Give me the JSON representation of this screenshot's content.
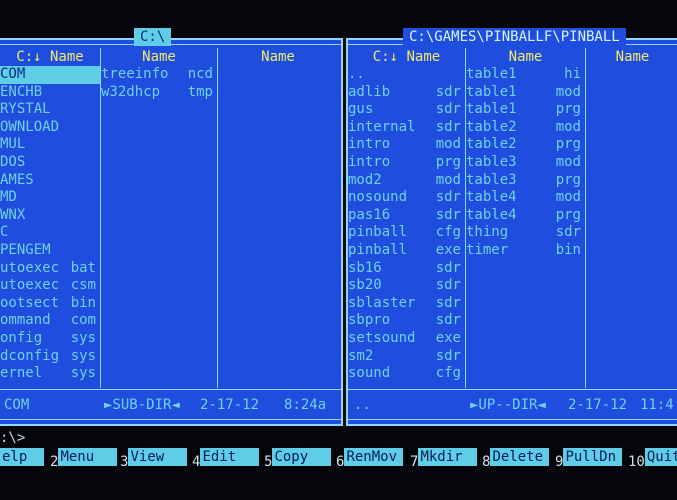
{
  "left": {
    "path": "C:\\",
    "columns": [
      {
        "header": "C:↓ Name",
        "entries": [
          {
            "name": "COM",
            "ext": "",
            "selected": true
          },
          {
            "name": "ENCHB",
            "ext": ""
          },
          {
            "name": "RYSTAL",
            "ext": ""
          },
          {
            "name": "OWNLOAD",
            "ext": ""
          },
          {
            "name": "MUL",
            "ext": ""
          },
          {
            "name": "DOS",
            "ext": ""
          },
          {
            "name": "AMES",
            "ext": ""
          },
          {
            "name": "MD",
            "ext": ""
          },
          {
            "name": "WNX",
            "ext": ""
          },
          {
            "name": "C",
            "ext": ""
          },
          {
            "name": "PENGEM",
            "ext": ""
          },
          {
            "name": "utoexec",
            "ext": "bat"
          },
          {
            "name": "utoexec",
            "ext": "csm"
          },
          {
            "name": "ootsect",
            "ext": "bin"
          },
          {
            "name": "ommand",
            "ext": "com"
          },
          {
            "name": "onfig",
            "ext": "sys"
          },
          {
            "name": "dconfig",
            "ext": "sys"
          },
          {
            "name": "ernel",
            "ext": "sys"
          }
        ]
      },
      {
        "header": "Name",
        "entries": [
          {
            "name": "treeinfo",
            "ext": "ncd"
          },
          {
            "name": "w32dhcp",
            "ext": "tmp"
          }
        ]
      },
      {
        "header": "Name",
        "entries": []
      }
    ],
    "status": {
      "name": "COM",
      "type": "►SUB-DIR◄",
      "date": "2-17-12",
      "time": "8:24a"
    }
  },
  "right": {
    "path": "C:\\GAMES\\PINBALLF\\PINBALL",
    "columns": [
      {
        "header": "C:↓ Name",
        "entries": [
          {
            "name": "..",
            "ext": ""
          },
          {
            "name": "adlib",
            "ext": "sdr"
          },
          {
            "name": "gus",
            "ext": "sdr"
          },
          {
            "name": "internal",
            "ext": "sdr"
          },
          {
            "name": "intro",
            "ext": "mod"
          },
          {
            "name": "intro",
            "ext": "prg"
          },
          {
            "name": "mod2",
            "ext": "mod"
          },
          {
            "name": "nosound",
            "ext": "sdr"
          },
          {
            "name": "pas16",
            "ext": "sdr"
          },
          {
            "name": "pinball",
            "ext": "cfg"
          },
          {
            "name": "pinball",
            "ext": "exe"
          },
          {
            "name": "sb16",
            "ext": "sdr"
          },
          {
            "name": "sb20",
            "ext": "sdr"
          },
          {
            "name": "sblaster",
            "ext": "sdr"
          },
          {
            "name": "sbpro",
            "ext": "sdr"
          },
          {
            "name": "setsound",
            "ext": "exe"
          },
          {
            "name": "sm2",
            "ext": "sdr"
          },
          {
            "name": "sound",
            "ext": "cfg"
          }
        ]
      },
      {
        "header": "Name",
        "entries": [
          {
            "name": "table1",
            "ext": "hi"
          },
          {
            "name": "table1",
            "ext": "mod"
          },
          {
            "name": "table1",
            "ext": "prg"
          },
          {
            "name": "table2",
            "ext": "mod"
          },
          {
            "name": "table2",
            "ext": "prg"
          },
          {
            "name": "table3",
            "ext": "mod"
          },
          {
            "name": "table3",
            "ext": "prg"
          },
          {
            "name": "table4",
            "ext": "mod"
          },
          {
            "name": "table4",
            "ext": "prg"
          },
          {
            "name": "thing",
            "ext": "sdr"
          },
          {
            "name": "timer",
            "ext": "bin"
          }
        ]
      },
      {
        "header": "Name",
        "entries": []
      }
    ],
    "status": {
      "name": "..",
      "type": "►UP--DIR◄",
      "date": "2-17-12",
      "time": "11:4"
    }
  },
  "cmdline": {
    "prompt": ":\\>"
  },
  "fkeys": [
    {
      "num": "",
      "label": "elp"
    },
    {
      "num": "2",
      "label": "Menu"
    },
    {
      "num": "3",
      "label": "View"
    },
    {
      "num": "4",
      "label": "Edit"
    },
    {
      "num": "5",
      "label": "Copy"
    },
    {
      "num": "6",
      "label": "RenMov"
    },
    {
      "num": "7",
      "label": "Mkdir"
    },
    {
      "num": "8",
      "label": "Delete"
    },
    {
      "num": "9",
      "label": "PullDn"
    },
    {
      "num": "10",
      "label": "Quit"
    }
  ],
  "colors": {
    "panel_bg": "#1f4ede",
    "frame": "#8fd7ff",
    "text": "#6fd0ea",
    "header": "#f2e96a",
    "highlight": "#5fcde6"
  }
}
